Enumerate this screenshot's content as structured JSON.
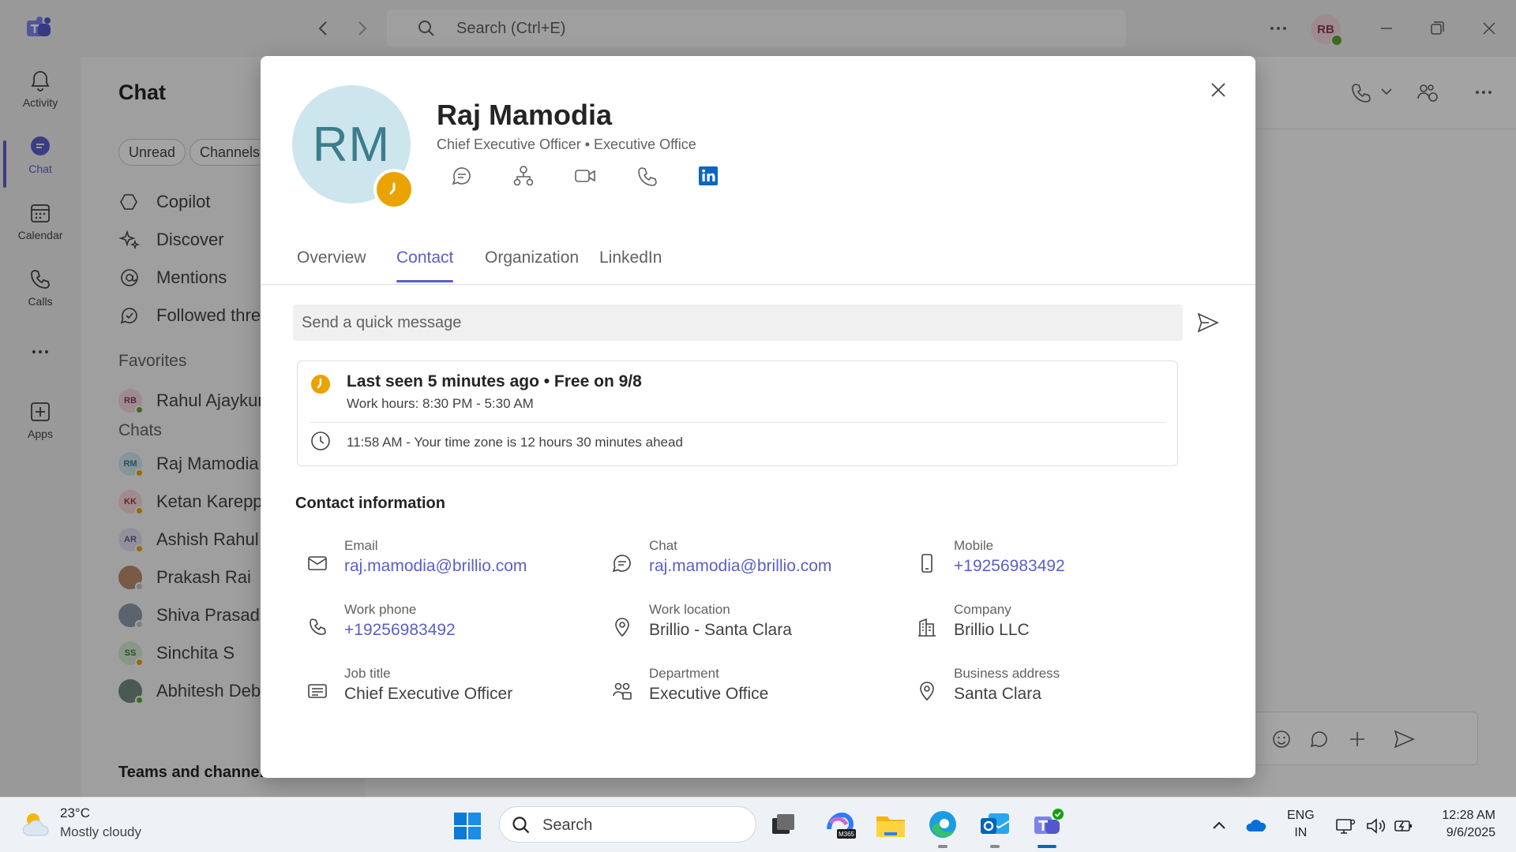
{
  "titlebar": {
    "search_placeholder": "Search (Ctrl+E)",
    "user_initials": "RB"
  },
  "rail": {
    "items": [
      {
        "label": "Activity"
      },
      {
        "label": "Chat"
      },
      {
        "label": "Calendar"
      },
      {
        "label": "Calls"
      },
      {
        "label": "Apps"
      }
    ]
  },
  "chatpane": {
    "title": "Chat",
    "filters": [
      "Unread",
      "Channels"
    ],
    "nav": [
      "Copilot",
      "Discover",
      "Mentions",
      "Followed threa"
    ],
    "favorites_label": "Favorites",
    "favorites": [
      {
        "initials": "RB",
        "name": "Rahul Ajaykum"
      }
    ],
    "chats_label": "Chats",
    "chats": [
      {
        "initials": "RM",
        "name": "Raj Mamodia"
      },
      {
        "initials": "KK",
        "name": "Ketan Kareppa"
      },
      {
        "initials": "AR",
        "name": "Ashish Rahul"
      },
      {
        "initials": "",
        "name": "Prakash Rai"
      },
      {
        "initials": "",
        "name": "Shiva Prasad K"
      },
      {
        "initials": "SS",
        "name": "Sinchita S"
      },
      {
        "initials": "",
        "name": "Abhitesh Debr"
      }
    ],
    "teams_label": "Teams and channels"
  },
  "profile": {
    "initials": "RM",
    "name": "Raj Mamodia",
    "subtitle": "Chief Executive Officer • Executive Office",
    "tabs": [
      "Overview",
      "Contact",
      "Organization",
      "LinkedIn"
    ],
    "active_tab": "Contact",
    "quick_message_placeholder": "Send a quick message",
    "status": {
      "line1": "Last seen 5 minutes ago • Free on 9/8",
      "line2": "Work hours: 8:30 PM - 5:30 AM",
      "line3": "11:58 AM - Your time zone is 12 hours 30 minutes ahead",
      "status_color": "#eaa300"
    },
    "contact_title": "Contact information",
    "contact": {
      "email": {
        "label": "Email",
        "value": "raj.mamodia@brillio.com"
      },
      "chat": {
        "label": "Chat",
        "value": "raj.mamodia@brillio.com"
      },
      "mobile": {
        "label": "Mobile",
        "value": "+19256983492"
      },
      "work_phone": {
        "label": "Work phone",
        "value": "+19256983492"
      },
      "work_location": {
        "label": "Work location",
        "value": "Brillio - Santa Clara"
      },
      "company": {
        "label": "Company",
        "value": "Brillio LLC"
      },
      "job_title": {
        "label": "Job title",
        "value": "Chief Executive Officer"
      },
      "department": {
        "label": "Department",
        "value": "Executive Office"
      },
      "business_address": {
        "label": "Business address",
        "value": "Santa Clara"
      }
    }
  },
  "taskbar": {
    "temperature": "23°C",
    "condition": "Mostly cloudy",
    "search_label": "Search",
    "lang_line1": "ENG",
    "lang_line2": "IN",
    "time": "12:28 AM",
    "date": "9/6/2025"
  },
  "colors": {
    "accent": "#5b5fc7",
    "away": "#eaa300",
    "available": "#5ea52d"
  }
}
